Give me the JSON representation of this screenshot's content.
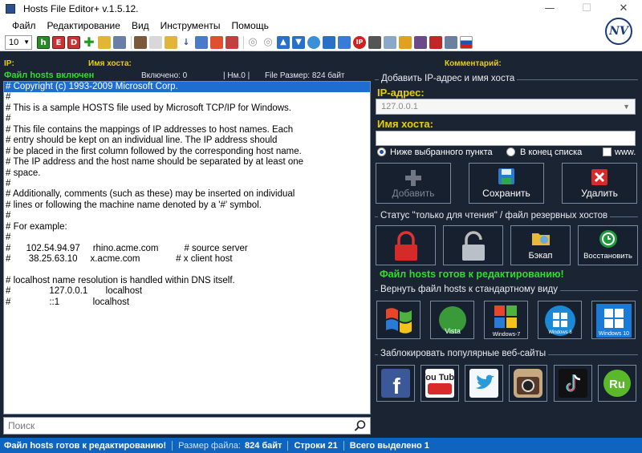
{
  "window": {
    "title": "Hosts File Editor+ v.1.5.12.",
    "minimize": "—",
    "maximize": "☐",
    "close": "✕"
  },
  "menu": [
    "Файл",
    "Редактирование",
    "Вид",
    "Инструменты",
    "Помощь"
  ],
  "logo_text": "NV",
  "toolbar": {
    "font_size": "10",
    "icons": [
      "hosts-h-icon",
      "hosts-e-icon",
      "hosts-d-icon",
      "add-icon",
      "open-icon",
      "save-icon",
      "tools-icon",
      "edit-icon",
      "folder-icon",
      "sort-icon",
      "copy-icon",
      "paste-icon",
      "delete-icon",
      "check-icon",
      "uncheck-icon",
      "up-icon",
      "down-icon",
      "network-icon",
      "config-icon",
      "info-icon",
      "ip-icon",
      "dns-icon",
      "grid-icon",
      "clean-icon",
      "backup-icon",
      "pin-icon",
      "language-icon"
    ]
  },
  "columns": {
    "ip": "IP:",
    "host": "Имя хоста:",
    "comment": "Комментарий:"
  },
  "status_strip": {
    "hosts_on": "Файл hosts включен",
    "enabled": "Включено: 0",
    "nm": "| Нм.0 |",
    "size": "File Размер: 824 байт"
  },
  "editor_lines": [
    "# Copyright (c) 1993-2009 Microsoft Corp.",
    "#",
    "# This is a sample HOSTS file used by Microsoft TCP/IP for Windows.",
    "#",
    "# This file contains the mappings of IP addresses to host names. Each",
    "# entry should be kept on an individual line. The IP address should",
    "# be placed in the first column followed by the corresponding host name.",
    "# The IP address and the host name should be separated by at least one",
    "# space.",
    "#",
    "# Additionally, comments (such as these) may be inserted on individual",
    "# lines or following the machine name denoted by a '#' symbol.",
    "#",
    "# For example:",
    "#",
    "#      102.54.94.97     rhino.acme.com          # source server",
    "#       38.25.63.10     x.acme.com              # x client host",
    "",
    "# localhost name resolution is handled within DNS itself.",
    "#               127.0.0.1       localhost",
    "#               ::1             localhost"
  ],
  "search": {
    "placeholder": "Поиск"
  },
  "add_panel": {
    "title": "Добавить IP-адрес и имя хоста",
    "ip_label": "IP-адрес:",
    "ip_value": "127.0.0.1",
    "host_label": "Имя хоста:",
    "host_value": "",
    "radio_below": "Ниже выбранного пункта",
    "radio_end": "В конец списка",
    "www_label": "www.",
    "btn_add": "Добавить",
    "btn_save": "Сохранить",
    "btn_delete": "Удалить"
  },
  "status_panel": {
    "title": "Статус \"только для чтения\" / файл резервных хостов",
    "btn_backup": "Бэкап",
    "btn_restore": "Восстановить",
    "ready_text": "Файл hosts готов к редактированию!"
  },
  "restore_panel": {
    "title": "Вернуть файл hosts к стандартному виду",
    "os": [
      "Windows XP",
      "Vista",
      "Windows 7",
      "Windows 8",
      "Windows 10"
    ],
    "win7_label": "Windows-7",
    "win8_label": "Windows 8",
    "win10_label": "Windows 10",
    "vista_label": "Vista"
  },
  "block_panel": {
    "title": "Заблокировать популярные веб-сайты",
    "sites": [
      "facebook",
      "youtube",
      "twitter",
      "instagram",
      "tiktok",
      "rutube"
    ],
    "youtube_label": "You Tube",
    "ru_label": "Ru"
  },
  "statusbar": {
    "ready": "Файл hosts готов к редактированию!",
    "size_label": "Размер файла:",
    "size_value": "824 байт",
    "lines": "Строки 21",
    "selected": "Всего выделено 1"
  },
  "colors": {
    "background": "#1b2433",
    "accent_yellow": "#e8d000",
    "ok_green": "#2fdc2f",
    "statusbar_blue": "#0f64c0",
    "selection_blue": "#1f6dd1"
  }
}
